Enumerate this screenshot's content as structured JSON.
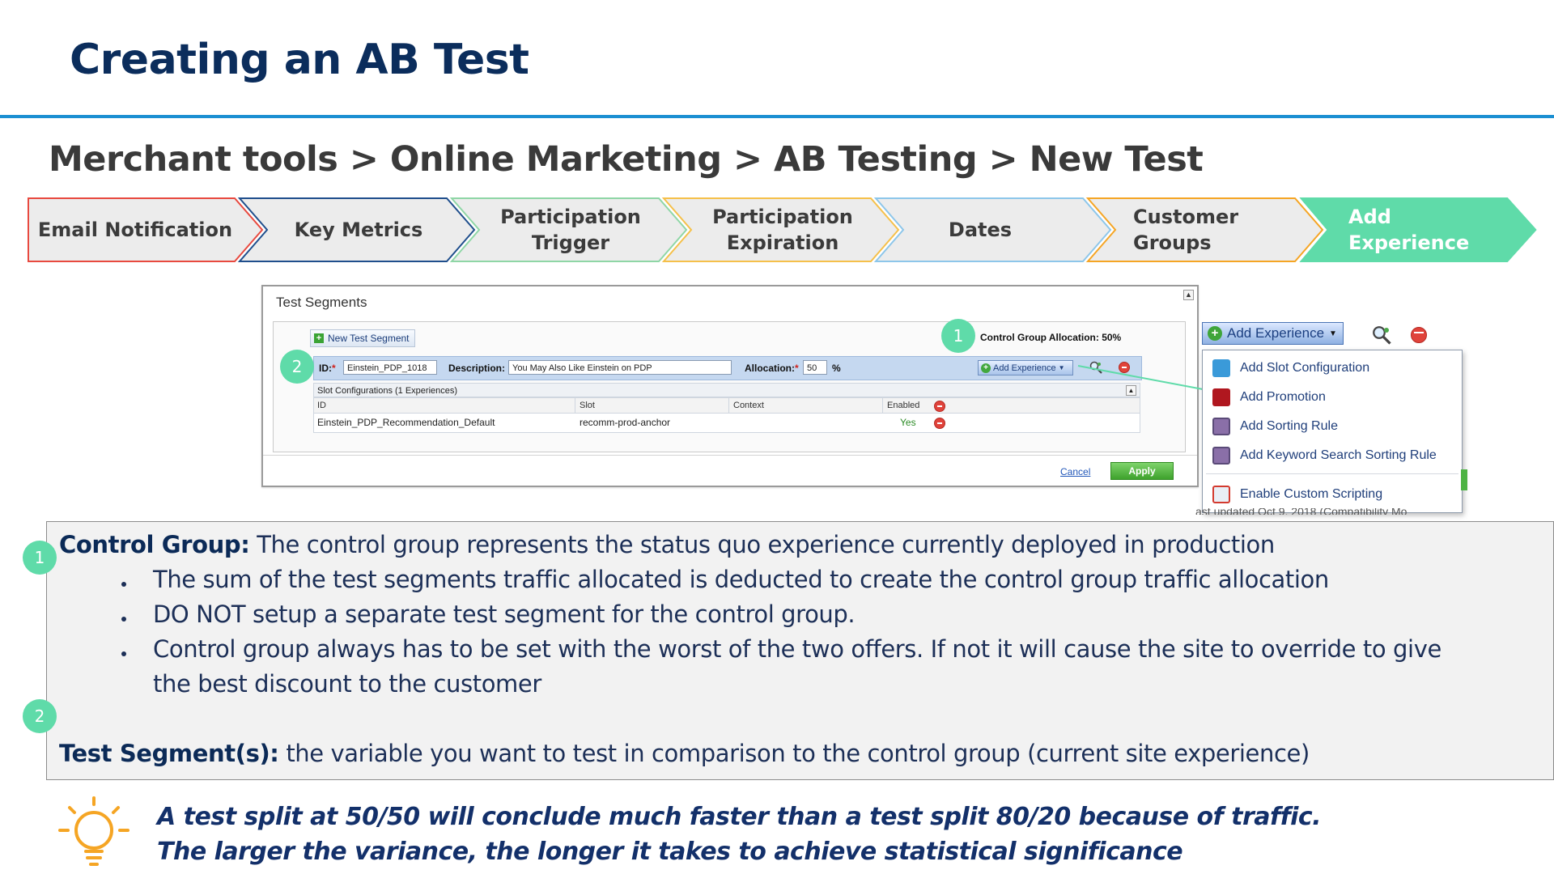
{
  "slide": {
    "title": "Creating an AB Test",
    "breadcrumb": "Merchant tools > Online Marketing > AB Testing > New Test"
  },
  "steps": [
    {
      "line1": "Email Notification",
      "line2": "",
      "color": "#e8493f",
      "active": false
    },
    {
      "line1": "Key Metrics",
      "line2": "",
      "color": "#1f4e8c",
      "active": false
    },
    {
      "line1": "Participation",
      "line2": "Trigger",
      "color": "#8fd6a6",
      "active": false
    },
    {
      "line1": "Participation",
      "line2": "Expiration",
      "color": "#f5c04a",
      "active": false
    },
    {
      "line1": "Dates",
      "line2": "",
      "color": "#8dc6ea",
      "active": false
    },
    {
      "line1": "Customer",
      "line2": "Groups",
      "color": "#f5a524",
      "active": false
    },
    {
      "line1": "Add",
      "line2": "Experience",
      "color": "#5fdba9",
      "active": true
    }
  ],
  "panel": {
    "title": "Test Segments",
    "new_segment_label": "New Test Segment",
    "control_alloc": "Control Group Allocation: 50%",
    "id_label": "ID:",
    "id_value": "Einstein_PDP_1018",
    "desc_label": "Description:",
    "desc_value": "You May Also Like Einstein on PDP",
    "alloc_label": "Allocation:",
    "alloc_value": "50",
    "alloc_unit": "%",
    "add_experience": "Add Experience",
    "slot_configs": "Slot Configurations (1 Experiences)",
    "columns": {
      "id": "ID",
      "slot": "Slot",
      "context": "Context",
      "enabled": "Enabled"
    },
    "row": {
      "id": "Einstein_PDP_Recommendation_Default",
      "slot": "recomm-prod-anchor",
      "context": "",
      "enabled": "Yes"
    },
    "cancel": "Cancel",
    "apply": "Apply"
  },
  "dropdown": {
    "button": "Add Experience",
    "items": [
      {
        "label": "Add Slot Configuration",
        "icon": "slot-config-icon"
      },
      {
        "label": "Add Promotion",
        "icon": "promotion-icon"
      },
      {
        "label": "Add Sorting Rule",
        "icon": "sorting-rule-icon"
      },
      {
        "label": "Add Keyword Search Sorting Rule",
        "icon": "keyword-sorting-icon"
      },
      {
        "label": "Enable Custom Scripting",
        "icon": "custom-scripting-icon"
      }
    ],
    "cut_text": "ast updated Oct 9, 2018 (Compatibility Mo"
  },
  "badges": {
    "one": "1",
    "two": "2"
  },
  "info": {
    "cg_title": "Control Group:",
    "cg_text": " The control group represents the status quo experience currently deployed in production",
    "bullets": [
      "The sum of the test segments traffic allocated is deducted to create the control group traffic allocation",
      "DO NOT setup a separate test segment for the control group.",
      "Control group always has to be set with the worst of the two offers.  If not it will cause the site to override to give"
    ],
    "bullet3_cont": "the best discount to the customer",
    "ts_title": "Test Segment(s):",
    "ts_text": " the variable you want to test in comparison to the control group (current site experience)"
  },
  "tip": {
    "line1": "A test split at 50/50 will conclude much faster than a test split 80/20 because of traffic.",
    "line2": "The larger the variance, the longer it takes to achieve statistical significance"
  },
  "colors": {
    "title": "#0b2d5c",
    "rule": "#1b8fd2",
    "badge": "#5fdba9",
    "tip_icon": "#f5a524"
  }
}
